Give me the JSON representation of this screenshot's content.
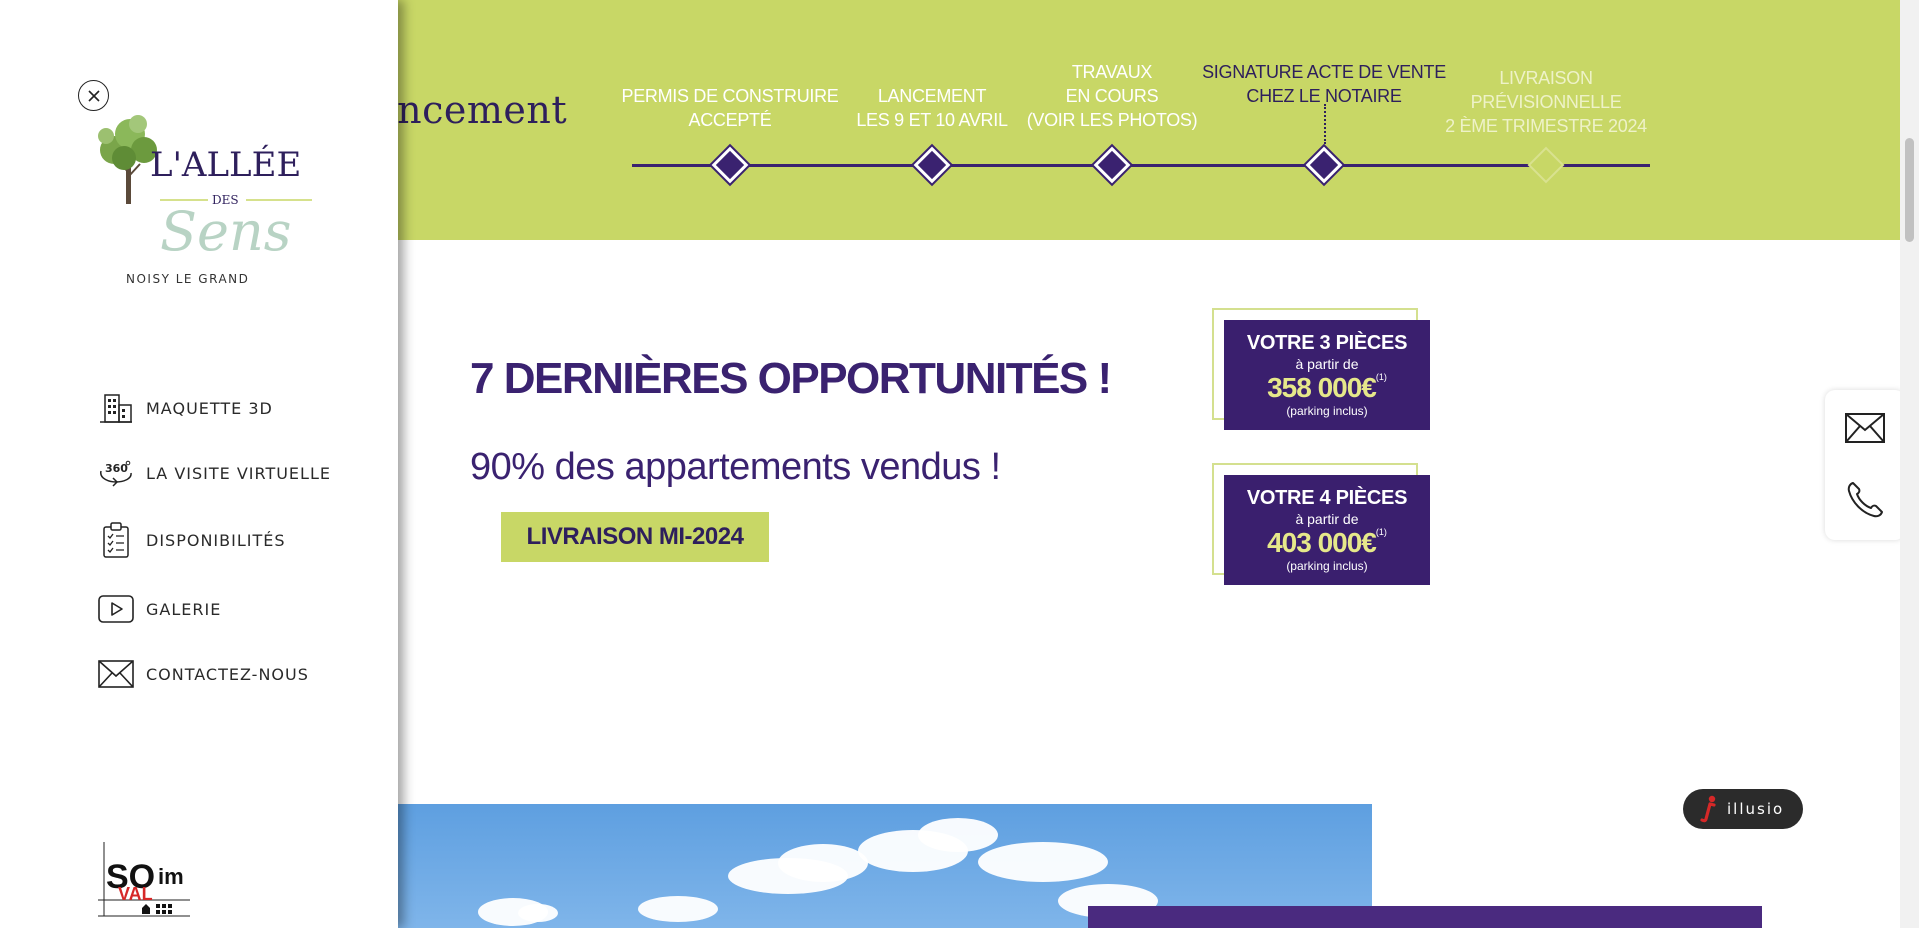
{
  "progress": {
    "title_fragment": "vancement",
    "milestones": [
      {
        "lines": [
          "PERMIS DE CONSTRUIRE",
          "ACCEPTÉ"
        ],
        "status": "done"
      },
      {
        "lines": [
          "LANCEMENT",
          "LES 9 ET 10 AVRIL"
        ],
        "status": "done"
      },
      {
        "lines": [
          "TRAVAUX",
          "EN COURS",
          "(VOIR LES PHOTOS)"
        ],
        "status": "done"
      },
      {
        "lines": [
          "SIGNATURE ACTE DE VENTE",
          "CHEZ LE NOTAIRE"
        ],
        "status": "current"
      },
      {
        "lines": [
          "LIVRAISON",
          "PRÉVISIONNELLE",
          "2 ÈME TRIMESTRE 2024"
        ],
        "status": "upcoming"
      }
    ]
  },
  "offer": {
    "headline": "7 DERNIÈRES OPPORTUNITÉS !",
    "sold_text": "90% des appartements vendus !",
    "delivery_badge": "LIVRAISON MI-2024"
  },
  "prices": [
    {
      "title": "VOTRE 3 PIÈCES",
      "from": "à partir de",
      "price": "358 000€",
      "note": "(1)",
      "parking": "(parking inclus)"
    },
    {
      "title": "VOTRE 4 PIÈCES",
      "from": "à partir de",
      "price": "403 000€",
      "note": "(1)",
      "parking": "(parking inclus)"
    }
  ],
  "side_menu": {
    "brand": {
      "line1": "L'ALLÉE",
      "line2": "DES",
      "line3": "Sens"
    },
    "location": "NOISY LE GRAND",
    "items": [
      {
        "label": "MAQUETTE 3D",
        "icon": "building-icon"
      },
      {
        "label": "LA VISITE VIRTUELLE",
        "icon": "360-icon"
      },
      {
        "label": "DISPONIBILITÉS",
        "icon": "clipboard-list-icon"
      },
      {
        "label": "GALERIE",
        "icon": "play-icon"
      },
      {
        "label": "CONTACTEZ-NOUS",
        "icon": "envelope-icon"
      }
    ],
    "promoter_logo": {
      "line1": "SO",
      "line2": "VAL",
      "line3": "im"
    }
  },
  "contact_widget": {
    "icons": [
      "envelope-icon",
      "phone-icon"
    ]
  },
  "illusio_badge": {
    "text": "illusio"
  },
  "colors": {
    "lime": "#c8d766",
    "purple": "#3a2270",
    "price_yellow": "#e6e88a"
  }
}
